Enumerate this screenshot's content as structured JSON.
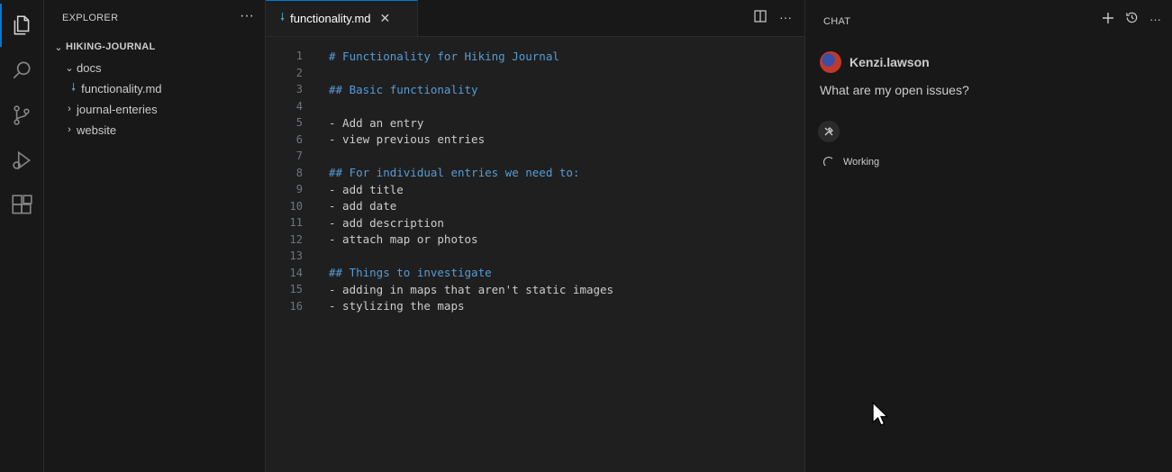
{
  "activity_bar": {
    "items": [
      "explorer-icon",
      "search-icon",
      "source-control-icon",
      "run-debug-icon",
      "extensions-icon"
    ]
  },
  "explorer": {
    "title": "EXPLORER",
    "more": "···",
    "project": "HIKING-JOURNAL",
    "tree": [
      {
        "label": "docs",
        "type": "folder",
        "expanded": true
      },
      {
        "label": "functionality.md",
        "type": "file"
      },
      {
        "label": "journal-enteries",
        "type": "folder",
        "expanded": false
      },
      {
        "label": "website",
        "type": "folder",
        "expanded": false
      }
    ]
  },
  "editor": {
    "tab_label": "functionality.md",
    "tab_close": "✕",
    "lines": [
      {
        "n": "1",
        "text": "# Functionality for Hiking Journal",
        "heading": true
      },
      {
        "n": "2",
        "text": "",
        "heading": false
      },
      {
        "n": "3",
        "text": "## Basic functionality",
        "heading": true
      },
      {
        "n": "4",
        "text": "",
        "heading": false
      },
      {
        "n": "5",
        "text": "- Add an entry",
        "heading": false
      },
      {
        "n": "6",
        "text": "- view previous entries",
        "heading": false
      },
      {
        "n": "7",
        "text": "",
        "heading": false
      },
      {
        "n": "8",
        "text": "## For individual entries we need to:",
        "heading": true
      },
      {
        "n": "9",
        "text": "- add title",
        "heading": false
      },
      {
        "n": "10",
        "text": "- add date",
        "heading": false
      },
      {
        "n": "11",
        "text": "- add description",
        "heading": false
      },
      {
        "n": "12",
        "text": "- attach map or photos",
        "heading": false
      },
      {
        "n": "13",
        "text": "",
        "heading": false
      },
      {
        "n": "14",
        "text": "## Things to investigate",
        "heading": true
      },
      {
        "n": "15",
        "text": "- adding in maps that aren't static images",
        "heading": false
      },
      {
        "n": "16",
        "text": "- stylizing the maps",
        "heading": false
      }
    ]
  },
  "chat": {
    "title": "CHAT",
    "user_name": "Kenzi.lawson",
    "message": "What are my open issues?",
    "status": "Working"
  },
  "colors": {
    "accent": "#0078d4",
    "heading": "#569cd6",
    "md_icon": "#519aba"
  }
}
